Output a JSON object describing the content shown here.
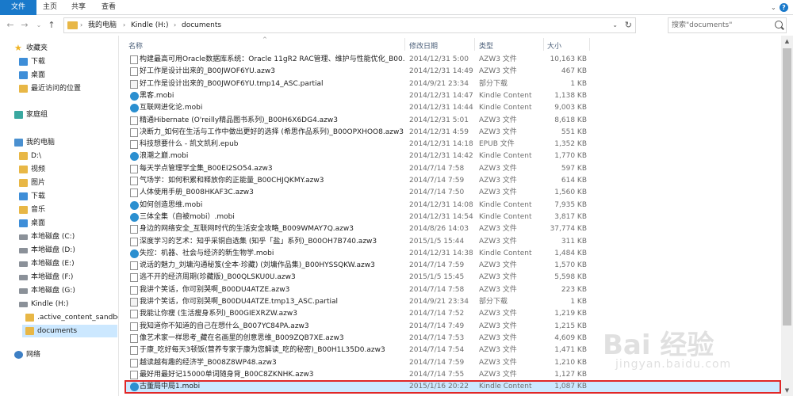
{
  "ribbon": {
    "tabs": [
      "文件",
      "主页",
      "共享",
      "查看"
    ]
  },
  "address": {
    "crumbs": [
      "我的电脑",
      "Kindle (H:)",
      "documents"
    ]
  },
  "search": {
    "placeholder": "搜索\"documents\""
  },
  "sidebar": {
    "items": [
      {
        "label": "收藏夹",
        "icon": "star-icon"
      },
      {
        "label": "下载",
        "icon": "download-folder-icon"
      },
      {
        "label": "桌面",
        "icon": "desktop-folder-icon"
      },
      {
        "label": "最近访问的位置",
        "icon": "recent-places-icon"
      },
      {
        "label": "家庭组",
        "icon": "homegroup-icon"
      },
      {
        "label": "我的电脑",
        "icon": "computer-icon"
      },
      {
        "label": "D:\\",
        "icon": "folder-icon"
      },
      {
        "label": "视频",
        "icon": "videos-folder-icon"
      },
      {
        "label": "图片",
        "icon": "pictures-folder-icon"
      },
      {
        "label": "下载",
        "icon": "download-folder-icon"
      },
      {
        "label": "音乐",
        "icon": "music-folder-icon"
      },
      {
        "label": "桌面",
        "icon": "desktop-folder-icon"
      },
      {
        "label": "本地磁盘 (C:)",
        "icon": "drive-icon"
      },
      {
        "label": "本地磁盘 (D:)",
        "icon": "drive-icon"
      },
      {
        "label": "本地磁盘 (E:)",
        "icon": "drive-icon"
      },
      {
        "label": "本地磁盘 (F:)",
        "icon": "drive-icon"
      },
      {
        "label": "本地磁盘 (G:)",
        "icon": "drive-icon"
      },
      {
        "label": "Kindle (H:)",
        "icon": "kindle-drive-icon"
      },
      {
        "label": ".active_content_sandbox",
        "icon": "folder-icon"
      },
      {
        "label": "documents",
        "icon": "folder-icon"
      },
      {
        "label": "网络",
        "icon": "network-icon"
      }
    ]
  },
  "columns": {
    "name": "名称",
    "date": "修改日期",
    "type": "类型",
    "size": "大小"
  },
  "files": [
    {
      "name": "构建最高可用Oracle数据库系统：Oracle 11gR2 RAC管理、维护与性能优化_B00...",
      "date": "2014/12/31 5:00",
      "type": "AZW3 文件",
      "size": "10,163 KB",
      "kind": "doc"
    },
    {
      "name": "好工作是设计出来的_B00JWOF6YU.azw3",
      "date": "2014/12/31 14:49",
      "type": "AZW3 文件",
      "size": "467 KB",
      "kind": "doc"
    },
    {
      "name": "好工作是设计出来的_B00JWOF6YU.tmp14_ASC.partial",
      "date": "2014/9/21 23:34",
      "type": "部分下载",
      "size": "1 KB",
      "kind": "partial"
    },
    {
      "name": "黑客.mobi",
      "date": "2014/12/31 14:47",
      "type": "Kindle Content",
      "size": "1,138 KB",
      "kind": "kindle"
    },
    {
      "name": "互联网进化论.mobi",
      "date": "2014/12/31 14:44",
      "type": "Kindle Content",
      "size": "9,003 KB",
      "kind": "kindle"
    },
    {
      "name": "精通Hibernate (O'reilly精品图书系列)_B00H6X6DG4.azw3",
      "date": "2014/12/31 5:01",
      "type": "AZW3 文件",
      "size": "8,618 KB",
      "kind": "doc"
    },
    {
      "name": "决断力_如何在生活与工作中做出更好的选择 (希思作品系列)_B00OPXHOO8.azw3",
      "date": "2014/12/31 4:59",
      "type": "AZW3 文件",
      "size": "551 KB",
      "kind": "doc"
    },
    {
      "name": "科技想要什么 - 凯文凯利.epub",
      "date": "2014/12/31 14:18",
      "type": "EPUB 文件",
      "size": "1,352 KB",
      "kind": "doc"
    },
    {
      "name": "浪潮之巅.mobi",
      "date": "2014/12/31 14:42",
      "type": "Kindle Content",
      "size": "1,770 KB",
      "kind": "kindle"
    },
    {
      "name": "每天学点管理学全集_B00EI2SO54.azw3",
      "date": "2014/7/14 7:58",
      "type": "AZW3 文件",
      "size": "597 KB",
      "kind": "doc"
    },
    {
      "name": "气场学：如何积累和释放你的正能量_B00CHJQKMY.azw3",
      "date": "2014/7/14 7:59",
      "type": "AZW3 文件",
      "size": "614 KB",
      "kind": "doc"
    },
    {
      "name": "人体使用手册_B008HKAF3C.azw3",
      "date": "2014/7/14 7:50",
      "type": "AZW3 文件",
      "size": "1,560 KB",
      "kind": "doc"
    },
    {
      "name": "如何创造思维.mobi",
      "date": "2014/12/31 14:08",
      "type": "Kindle Content",
      "size": "7,935 KB",
      "kind": "kindle"
    },
    {
      "name": "三体全集（自被mobi）.mobi",
      "date": "2014/12/31 14:54",
      "type": "Kindle Content",
      "size": "3,817 KB",
      "kind": "kindle"
    },
    {
      "name": "身边的网络安全_互联网时代的生活安全攻略_B009WMAY7Q.azw3",
      "date": "2014/8/26 14:03",
      "type": "AZW3 文件",
      "size": "37,774 KB",
      "kind": "doc"
    },
    {
      "name": "深度学习的艺术：知乎采铜自选集 (知乎「盐」系列)_B00OH7B740.azw3",
      "date": "2015/1/5 15:44",
      "type": "AZW3 文件",
      "size": "311 KB",
      "kind": "doc"
    },
    {
      "name": "失控：机器、社会与经济的新生物学.mobi",
      "date": "2014/12/31 14:38",
      "type": "Kindle Content",
      "size": "1,484 KB",
      "kind": "kindle"
    },
    {
      "name": "说话的魅力_刘墉沟通秘笈(全本·珍藏) (刘墉作品集)_B00HYSSQKW.azw3",
      "date": "2014/7/14 7:59",
      "type": "AZW3 文件",
      "size": "1,570 KB",
      "kind": "doc"
    },
    {
      "name": "逃不开的经济周期(珍藏版)_B00QLSKU0U.azw3",
      "date": "2015/1/5 15:45",
      "type": "AZW3 文件",
      "size": "5,598 KB",
      "kind": "doc"
    },
    {
      "name": "我讲个笑话，你可别哭啊_B00DU4ATZE.azw3",
      "date": "2014/7/14 7:58",
      "type": "AZW3 文件",
      "size": "223 KB",
      "kind": "doc"
    },
    {
      "name": "我讲个笑话，你可别哭啊_B00DU4ATZE.tmp13_ASC.partial",
      "date": "2014/9/21 23:34",
      "type": "部分下载",
      "size": "1 KB",
      "kind": "partial"
    },
    {
      "name": "我能让你瘦 (生活瘦身系列)_B00GIEXRZW.azw3",
      "date": "2014/7/14 7:52",
      "type": "AZW3 文件",
      "size": "1,219 KB",
      "kind": "doc"
    },
    {
      "name": "我知道你不知道的自己在想什么_B007YC84PA.azw3",
      "date": "2014/7/14 7:49",
      "type": "AZW3 文件",
      "size": "1,215 KB",
      "kind": "doc"
    },
    {
      "name": "像艺术家一样思考_藏在名画里的创意思维_B009ZQB7XE.azw3",
      "date": "2014/7/14 7:53",
      "type": "AZW3 文件",
      "size": "4,609 KB",
      "kind": "doc"
    },
    {
      "name": "于康_吃好每天3顿饭(营养专家于康为您解读_吃的秘密)_B00H1L35D0.azw3",
      "date": "2014/7/14 7:54",
      "type": "AZW3 文件",
      "size": "1,471 KB",
      "kind": "doc"
    },
    {
      "name": "越读越有趣的经济学_B008Z8WP48.azw3",
      "date": "2014/7/14 7:59",
      "type": "AZW3 文件",
      "size": "1,210 KB",
      "kind": "doc"
    },
    {
      "name": "最好用最好记15000单词随身背_B00C8ZKNHK.azw3",
      "date": "2014/7/14 7:55",
      "type": "AZW3 文件",
      "size": "1,127 KB",
      "kind": "doc"
    },
    {
      "name": "古董局中局1.mobi",
      "date": "2015/1/16 20:22",
      "type": "Kindle Content",
      "size": "1,087 KB",
      "kind": "kindle",
      "selected": true
    }
  ],
  "watermark": {
    "brand": "Bai 经验",
    "url": "jingyan.baidu.com"
  }
}
